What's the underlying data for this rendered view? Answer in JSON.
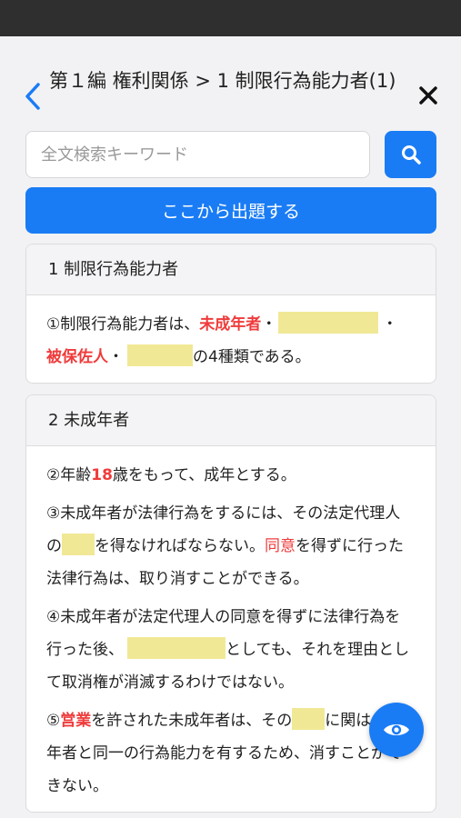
{
  "header": {
    "title": "第１編 権利関係 > 1 制限行為能力者(1)"
  },
  "search": {
    "placeholder": "全文検索キーワード",
    "value": ""
  },
  "quiz_button_label": "ここから出題する",
  "sections": [
    {
      "title": "1 制限行為能力者",
      "p1": {
        "t1": "①制限行為能力者は、",
        "r1": "未成年者",
        "t2": "・",
        "t3": "・",
        "r2": "被保佐人",
        "t4": "・",
        "t5": "の4種類である。"
      }
    },
    {
      "title": "2 未成年者",
      "p2": {
        "t1": "②年齢",
        "r1": "18",
        "t2": "歳をもって、成年とする。"
      },
      "p3": {
        "t1": "③未成年者が法律行為をするには、その法定代理人の",
        "t2": "を得なければならない。",
        "r1": "同意",
        "t3": "を得ずに行った法律行為は、取り消すことができる。"
      },
      "p4": {
        "t1": "④未成年者が法定代理人の同意を得ずに法律行為を行った後、",
        "t2": "としても、それを理由として取消権が消滅するわけではない。"
      },
      "p5": {
        "t1": "⑤",
        "r1": "営業",
        "t2": "を許された未成年者は、その",
        "t3": "に関",
        "t4": "は、成年者と同一の行為能力を有するため、",
        "t5": "消すことができない。"
      }
    }
  ],
  "colors": {
    "accent": "#1a7cf5",
    "highlight_red": "#ef3b3b",
    "blank_fill": "#f1e896"
  },
  "icons": {
    "back": "chevron-left-icon",
    "close": "close-icon",
    "search": "search-icon",
    "fab": "eye-icon"
  }
}
